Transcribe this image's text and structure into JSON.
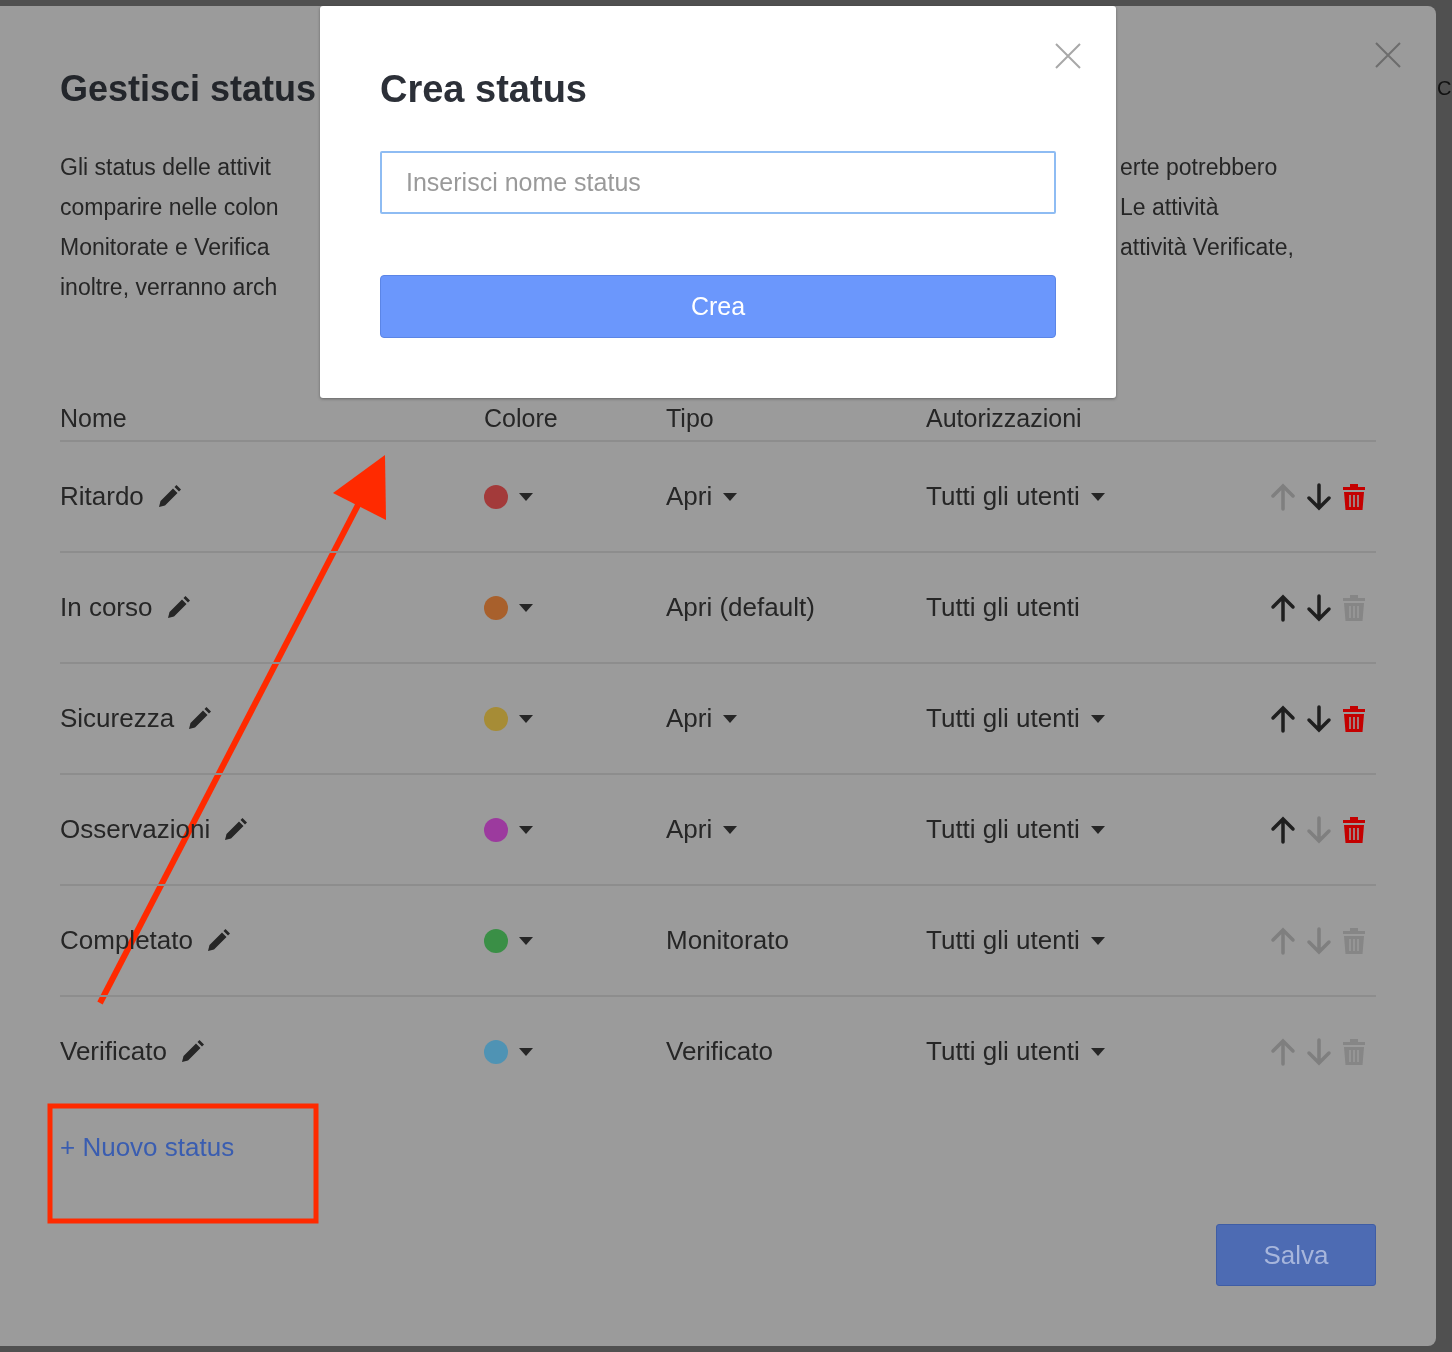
{
  "background_page": {
    "partial_text": "C"
  },
  "manage_dialog": {
    "title": "Gestisci status",
    "description": [
      {
        "left": "Gli status delle attivit",
        "right": "erte potrebbero"
      },
      {
        "left": "comparire nelle colon",
        "right": "Le attività"
      },
      {
        "left": "Monitorate e Verifica",
        "right": "attività Verificate,"
      },
      {
        "left": "inoltre, verranno arch"
      }
    ],
    "columns": [
      "Nome",
      "Colore",
      "Tipo",
      "Autorizzazioni"
    ],
    "rows": [
      {
        "name": "Ritardo",
        "color": "#a33a3a",
        "type": "Apri",
        "type_dropdown": true,
        "permissions": "Tutti gli utenti",
        "permissions_dropdown": true,
        "up_enabled": false,
        "down_enabled": true,
        "delete_enabled": true
      },
      {
        "name": "In corso",
        "color": "#a8602c",
        "type": "Apri (default)",
        "type_dropdown": false,
        "permissions": "Tutti gli utenti",
        "permissions_dropdown": false,
        "up_enabled": true,
        "down_enabled": true,
        "delete_enabled": false
      },
      {
        "name": "Sicurezza",
        "color": "#a68c36",
        "type": "Apri",
        "type_dropdown": true,
        "permissions": "Tutti gli utenti",
        "permissions_dropdown": true,
        "up_enabled": true,
        "down_enabled": true,
        "delete_enabled": true
      },
      {
        "name": "Osservazioni",
        "color": "#9c3a9e",
        "type": "Apri",
        "type_dropdown": true,
        "permissions": "Tutti gli utenti",
        "permissions_dropdown": true,
        "up_enabled": true,
        "down_enabled": false,
        "delete_enabled": true
      },
      {
        "name": "Completato",
        "color": "#3a8f46",
        "type": "Monitorato",
        "type_dropdown": false,
        "permissions": "Tutti gli utenti",
        "permissions_dropdown": true,
        "up_enabled": false,
        "down_enabled": false,
        "delete_enabled": false
      },
      {
        "name": "Verificato",
        "color": "#4f93b4",
        "type": "Verificato",
        "type_dropdown": false,
        "permissions": "Tutti gli utenti",
        "permissions_dropdown": true,
        "up_enabled": false,
        "down_enabled": false,
        "delete_enabled": false
      }
    ],
    "new_status_link": "+ Nuovo status",
    "save_button": "Salva"
  },
  "create_dialog": {
    "title": "Crea status",
    "name_field": {
      "placeholder": "Inserisci nome status"
    },
    "create_button": "Crea"
  }
}
